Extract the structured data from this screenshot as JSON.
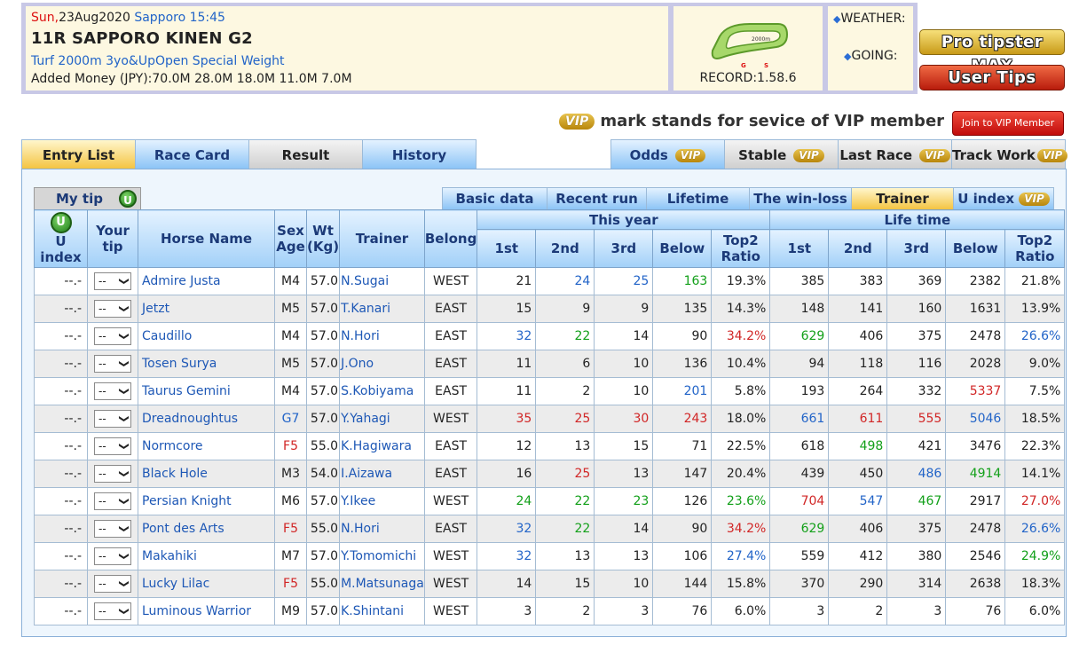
{
  "header": {
    "day": "Sun,",
    "date": "23Aug2020",
    "venue_time": "Sapporo 15:45",
    "race_title": "11R SAPPORO KINEN G2",
    "conditions": "Turf 2000m 3yo&UpOpen Special Weight",
    "added_money": "Added Money (JPY):70.0M 28.0M 18.0M 11.0M 7.0M",
    "course_distance": "2000m",
    "course_g": "G",
    "course_s": "S",
    "record": "RECORD:1.58.6",
    "weather_label": "WEATHER:",
    "going_label": "GOING:",
    "diamond": "◆"
  },
  "side_buttons": {
    "pro": "Pro tipster MAX",
    "user": "User Tips"
  },
  "vip_notice": {
    "badge": "VIP",
    "text": "mark stands for sevice of VIP member",
    "join": "Join to VIP Member"
  },
  "tabs": [
    {
      "label": "Entry List"
    },
    {
      "label": "Race Card"
    },
    {
      "label": "Result"
    },
    {
      "label": "History"
    },
    {
      "label": "Odds",
      "vip": "VIP"
    },
    {
      "label": "Stable",
      "vip": "VIP"
    },
    {
      "label": "Last Race",
      "vip": "VIP"
    },
    {
      "label": "Track Work",
      "vip": "VIP"
    }
  ],
  "subtabs": {
    "mytip": "My tip",
    "u": "U",
    "items": [
      "Basic data",
      "Recent run",
      "Lifetime",
      "The win-loss",
      "Trainer",
      "U index"
    ],
    "uindex_vip": "VIP"
  },
  "table": {
    "headers": {
      "u_index": "U index",
      "your_tip": [
        "Your",
        "tip"
      ],
      "horse_name": "Horse Name",
      "sex_age": [
        "Sex",
        "Age"
      ],
      "wt": [
        "Wt",
        "(Kg)"
      ],
      "trainer": "Trainer",
      "belong": "Belong",
      "this_year": "This year",
      "life_time": "Life time",
      "first": "1st",
      "second": "2nd",
      "third": "3rd",
      "below": "Below",
      "top2": [
        "Top2",
        "Ratio"
      ]
    },
    "select_value": "--",
    "rows": [
      {
        "u": "--.-",
        "name": "Admire Justa",
        "sa": "M4",
        "wt": "57.0",
        "trainer": "N.Sugai",
        "belong": "WEST",
        "y": [
          "21",
          "24",
          "25",
          "163",
          "19.3%"
        ],
        "l": [
          "385",
          "383",
          "369",
          "2382",
          "21.8%"
        ],
        "ys": [
          "",
          "b",
          "b",
          "g",
          ""
        ],
        "ls": [
          "",
          "",
          "",
          "",
          ""
        ],
        "sac": ""
      },
      {
        "u": "--.-",
        "name": "Jetzt",
        "sa": "M5",
        "wt": "57.0",
        "trainer": "T.Kanari",
        "belong": "EAST",
        "y": [
          "15",
          "9",
          "9",
          "135",
          "14.3%"
        ],
        "l": [
          "148",
          "141",
          "160",
          "1631",
          "13.9%"
        ],
        "ys": [
          "",
          "",
          "",
          "",
          ""
        ],
        "ls": [
          "",
          "",
          "",
          "",
          ""
        ],
        "sac": ""
      },
      {
        "u": "--.-",
        "name": "Caudillo",
        "sa": "M4",
        "wt": "57.0",
        "trainer": "N.Hori",
        "belong": "EAST",
        "y": [
          "32",
          "22",
          "14",
          "90",
          "34.2%"
        ],
        "l": [
          "629",
          "406",
          "375",
          "2478",
          "26.6%"
        ],
        "ys": [
          "b",
          "g",
          "",
          "",
          "r"
        ],
        "ls": [
          "g",
          "",
          "",
          "",
          "b"
        ],
        "sac": ""
      },
      {
        "u": "--.-",
        "name": "Tosen Surya",
        "sa": "M5",
        "wt": "57.0",
        "trainer": "J.Ono",
        "belong": "EAST",
        "y": [
          "11",
          "6",
          "10",
          "136",
          "10.4%"
        ],
        "l": [
          "94",
          "118",
          "116",
          "2028",
          "9.0%"
        ],
        "ys": [
          "",
          "",
          "",
          "",
          ""
        ],
        "ls": [
          "",
          "",
          "",
          "",
          ""
        ],
        "sac": ""
      },
      {
        "u": "--.-",
        "name": "Taurus Gemini",
        "sa": "M4",
        "wt": "57.0",
        "trainer": "S.Kobiyama",
        "belong": "EAST",
        "y": [
          "11",
          "2",
          "10",
          "201",
          "5.8%"
        ],
        "l": [
          "193",
          "264",
          "332",
          "5337",
          "7.5%"
        ],
        "ys": [
          "",
          "",
          "",
          "b",
          ""
        ],
        "ls": [
          "",
          "",
          "",
          "r",
          ""
        ],
        "sac": ""
      },
      {
        "u": "--.-",
        "name": "Dreadnoughtus",
        "sa": "G7",
        "wt": "57.0",
        "trainer": "Y.Yahagi",
        "belong": "WEST",
        "y": [
          "35",
          "25",
          "30",
          "243",
          "18.0%"
        ],
        "l": [
          "661",
          "611",
          "555",
          "5046",
          "18.5%"
        ],
        "ys": [
          "r",
          "r",
          "r",
          "r",
          ""
        ],
        "ls": [
          "b",
          "r",
          "r",
          "b",
          ""
        ],
        "sac": "b"
      },
      {
        "u": "--.-",
        "name": "Normcore",
        "sa": "F5",
        "wt": "55.0",
        "trainer": "K.Hagiwara",
        "belong": "EAST",
        "y": [
          "12",
          "13",
          "15",
          "71",
          "22.5%"
        ],
        "l": [
          "618",
          "498",
          "421",
          "3476",
          "22.3%"
        ],
        "ys": [
          "",
          "",
          "",
          "",
          ""
        ],
        "ls": [
          "",
          "g",
          "",
          "",
          ""
        ],
        "sac": "r"
      },
      {
        "u": "--.-",
        "name": "Black Hole",
        "sa": "M3",
        "wt": "54.0",
        "trainer": "I.Aizawa",
        "belong": "EAST",
        "y": [
          "16",
          "25",
          "13",
          "147",
          "20.4%"
        ],
        "l": [
          "439",
          "450",
          "486",
          "4914",
          "14.1%"
        ],
        "ys": [
          "",
          "r",
          "",
          "",
          ""
        ],
        "ls": [
          "",
          "",
          "b",
          "g",
          ""
        ],
        "sac": ""
      },
      {
        "u": "--.-",
        "name": "Persian Knight",
        "sa": "M6",
        "wt": "57.0",
        "trainer": "Y.Ikee",
        "belong": "WEST",
        "y": [
          "24",
          "22",
          "23",
          "126",
          "23.6%"
        ],
        "l": [
          "704",
          "547",
          "467",
          "2917",
          "27.0%"
        ],
        "ys": [
          "g",
          "g",
          "g",
          "",
          "g"
        ],
        "ls": [
          "r",
          "b",
          "g",
          "",
          "r"
        ],
        "sac": ""
      },
      {
        "u": "--.-",
        "name": "Pont des Arts",
        "sa": "F5",
        "wt": "55.0",
        "trainer": "N.Hori",
        "belong": "EAST",
        "y": [
          "32",
          "22",
          "14",
          "90",
          "34.2%"
        ],
        "l": [
          "629",
          "406",
          "375",
          "2478",
          "26.6%"
        ],
        "ys": [
          "b",
          "g",
          "",
          "",
          "r"
        ],
        "ls": [
          "g",
          "",
          "",
          "",
          "b"
        ],
        "sac": "r"
      },
      {
        "u": "--.-",
        "name": "Makahiki",
        "sa": "M7",
        "wt": "57.0",
        "trainer": "Y.Tomomichi",
        "belong": "WEST",
        "y": [
          "32",
          "13",
          "13",
          "106",
          "27.4%"
        ],
        "l": [
          "559",
          "412",
          "380",
          "2546",
          "24.9%"
        ],
        "ys": [
          "b",
          "",
          "",
          "",
          "b"
        ],
        "ls": [
          "",
          "",
          "",
          "",
          "g"
        ],
        "sac": ""
      },
      {
        "u": "--.-",
        "name": "Lucky Lilac",
        "sa": "F5",
        "wt": "55.0",
        "trainer": "M.Matsunaga",
        "belong": "WEST",
        "y": [
          "14",
          "15",
          "10",
          "144",
          "15.8%"
        ],
        "l": [
          "370",
          "290",
          "314",
          "2638",
          "18.3%"
        ],
        "ys": [
          "",
          "",
          "",
          "",
          ""
        ],
        "ls": [
          "",
          "",
          "",
          "",
          ""
        ],
        "sac": "r"
      },
      {
        "u": "--.-",
        "name": "Luminous Warrior",
        "sa": "M9",
        "wt": "57.0",
        "trainer": "K.Shintani",
        "belong": "WEST",
        "y": [
          "3",
          "2",
          "3",
          "76",
          "6.0%"
        ],
        "l": [
          "3",
          "2",
          "3",
          "76",
          "6.0%"
        ],
        "ys": [
          "",
          "",
          "",
          "",
          ""
        ],
        "ls": [
          "",
          "",
          "",
          "",
          ""
        ],
        "sac": ""
      }
    ]
  },
  "colors": {
    "link_blue": "#2264c8",
    "green": "#13a01a",
    "red": "#d12626",
    "header_lavender": "#c8c8e6",
    "panel_bg": "#eef6fd"
  }
}
